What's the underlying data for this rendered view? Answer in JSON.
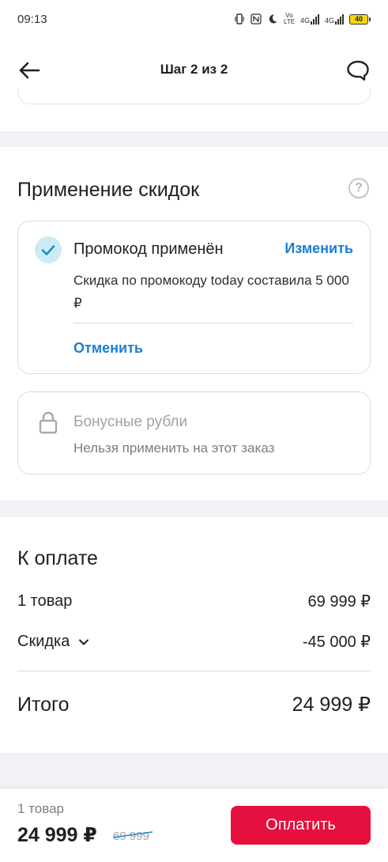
{
  "status_bar": {
    "time": "09:13",
    "net_volte": "Vo LTE",
    "net_4g_1": "4G",
    "net_4g_2": "4G",
    "battery": "40"
  },
  "header": {
    "title": "Шаг 2 из 2",
    "back_icon": "arrow-left-icon",
    "chat_icon": "chat-bubble-icon"
  },
  "discounts": {
    "title": "Применение скидок",
    "help_glyph": "?",
    "promo": {
      "title": "Промокод применён",
      "change_label": "Изменить",
      "description": "Скидка по промокоду today составила 5 000 ₽",
      "cancel_label": "Отменить",
      "check_color": "#1a8fc9"
    },
    "bonus": {
      "title": "Бонусные рубли",
      "description": "Нельзя применить на этот заказ"
    }
  },
  "payment": {
    "title": "К оплате",
    "items_label": "1 товар",
    "items_value": "69 999 ₽",
    "discount_label": "Скидка",
    "discount_value": "-45 000 ₽",
    "total_label": "Итого",
    "total_value": "24 999 ₽"
  },
  "bottom_bar": {
    "count": "1 товар",
    "price": "24 999 ₽",
    "old_price": "69 999",
    "pay_label": "Оплатить",
    "pay_color": "#e5103e"
  },
  "colors": {
    "accent_link": "#1a7fd4",
    "background_band": "#f2f2f6"
  }
}
